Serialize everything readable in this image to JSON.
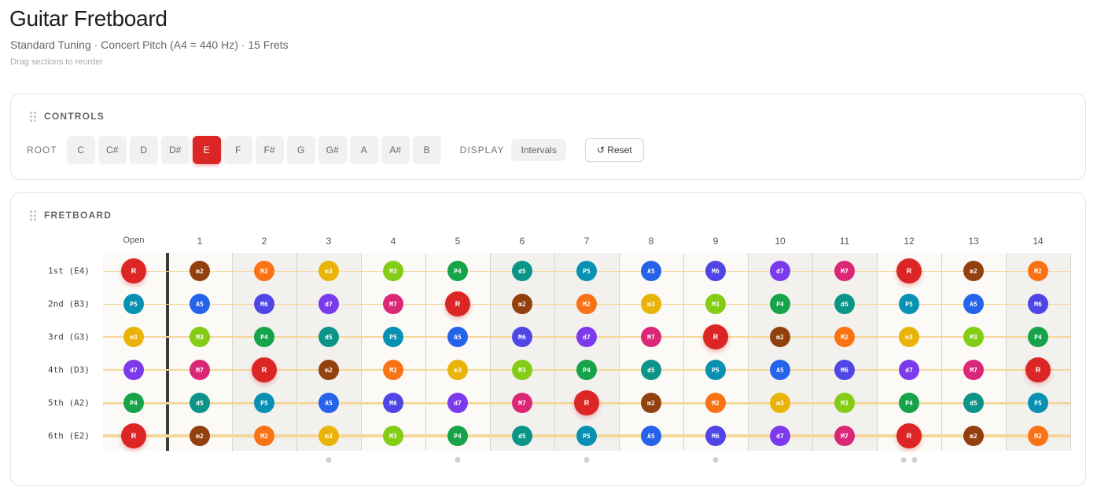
{
  "header": {
    "title": "Guitar Fretboard",
    "subtitle": "Standard Tuning · Concert Pitch (A4 = 440 Hz) · 15 Frets",
    "hint": "Drag sections to reorder"
  },
  "controls": {
    "title": "CONTROLS",
    "root_label": "ROOT",
    "notes": [
      "C",
      "C#",
      "D",
      "D#",
      "E",
      "F",
      "F#",
      "G",
      "G#",
      "A",
      "A#",
      "B"
    ],
    "selected_root": "E",
    "display_label": "DISPLAY",
    "display_value": "Intervals",
    "reset_label": "↺ Reset",
    "accent_color": "#dc2626"
  },
  "fretboard": {
    "title": "FRETBOARD",
    "fret_headers": [
      "Open",
      "1",
      "2",
      "3",
      "4",
      "5",
      "6",
      "7",
      "8",
      "9",
      "10",
      "11",
      "12",
      "13",
      "14"
    ],
    "strings": [
      {
        "label": "1st (E4)",
        "intervals": [
          "R",
          "m2",
          "M2",
          "m3",
          "M3",
          "P4",
          "d5",
          "P5",
          "A5",
          "M6",
          "d7",
          "M7",
          "R",
          "m2",
          "M2"
        ]
      },
      {
        "label": "2nd (B3)",
        "intervals": [
          "P5",
          "A5",
          "M6",
          "d7",
          "M7",
          "R",
          "m2",
          "M2",
          "m3",
          "M3",
          "P4",
          "d5",
          "P5",
          "A5",
          "M6"
        ]
      },
      {
        "label": "3rd (G3)",
        "intervals": [
          "m3",
          "M3",
          "P4",
          "d5",
          "P5",
          "A5",
          "M6",
          "d7",
          "M7",
          "R",
          "m2",
          "M2",
          "m3",
          "M3",
          "P4"
        ]
      },
      {
        "label": "4th (D3)",
        "intervals": [
          "d7",
          "M7",
          "R",
          "m2",
          "M2",
          "m3",
          "M3",
          "P4",
          "d5",
          "P5",
          "A5",
          "M6",
          "d7",
          "M7",
          "R"
        ]
      },
      {
        "label": "5th (A2)",
        "intervals": [
          "P4",
          "d5",
          "P5",
          "A5",
          "M6",
          "d7",
          "M7",
          "R",
          "m2",
          "M2",
          "m3",
          "M3",
          "P4",
          "d5",
          "P5"
        ]
      },
      {
        "label": "6th (E2)",
        "intervals": [
          "R",
          "m2",
          "M2",
          "m3",
          "M3",
          "P4",
          "d5",
          "P5",
          "A5",
          "M6",
          "d7",
          "M7",
          "R",
          "m2",
          "M2"
        ]
      }
    ],
    "interval_colors": {
      "R": "#dc2626",
      "m2": "#92400e",
      "M2": "#f97316",
      "m3": "#eab308",
      "M3": "#84cc16",
      "P4": "#16a34a",
      "d5": "#0d9488",
      "P5": "#0891b2",
      "A5": "#2563eb",
      "M6": "#4f46e5",
      "d7": "#7c3aed",
      "M7": "#db2777"
    },
    "inlay_frets": [
      3,
      5,
      7,
      9,
      12
    ]
  }
}
